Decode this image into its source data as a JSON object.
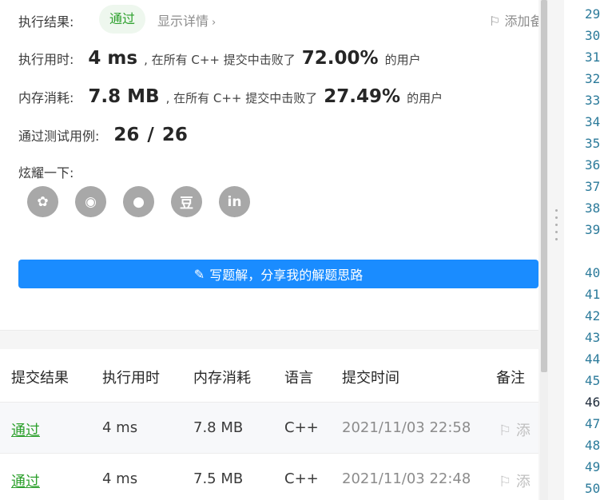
{
  "result": {
    "status_label": "执行结果:",
    "status_badge": "通过",
    "details_link": "显示详情",
    "details_chevron": "›",
    "add_note": "添加备",
    "runtime": {
      "label": "执行用时:",
      "value": "4 ms",
      "beat_prefix": ", 在所有 C++ 提交中击败了",
      "percent": "72.00%",
      "suffix": "的用户"
    },
    "memory": {
      "label": "内存消耗:",
      "value": "7.8 MB",
      "beat_prefix": ", 在所有 C++ 提交中击败了",
      "percent": "27.49%",
      "suffix": "的用户"
    },
    "testcases": {
      "label": "通过测试用例:",
      "passed": "26",
      "separator": "/",
      "total": "26"
    },
    "share": {
      "label": "炫耀一下:",
      "icons": [
        {
          "name": "wechat-icon",
          "glyph": "✿"
        },
        {
          "name": "weibo-icon",
          "glyph": "◉"
        },
        {
          "name": "qq-icon",
          "glyph": "●"
        },
        {
          "name": "douban-icon",
          "glyph": "豆"
        },
        {
          "name": "linkedin-icon",
          "glyph": "in"
        }
      ]
    },
    "write_solution_button": "写题解，分享我的解题思路",
    "pencil_glyph": "✎"
  },
  "table": {
    "headers": [
      "提交结果",
      "执行用时",
      "内存消耗",
      "语言",
      "提交时间",
      "备注"
    ],
    "rows": [
      {
        "result": "通过",
        "runtime": "4 ms",
        "memory": "7.8 MB",
        "language": "C++",
        "time": "2021/11/03 22:58",
        "note": "添"
      },
      {
        "result": "通过",
        "runtime": "4 ms",
        "memory": "7.5 MB",
        "language": "C++",
        "time": "2021/11/03 22:48",
        "note": "添"
      }
    ]
  },
  "editor": {
    "line_numbers": [
      "29",
      "30",
      "31",
      "32",
      "33",
      "34",
      "35",
      "36",
      "37",
      "38",
      "39",
      "40",
      "41",
      "42",
      "43",
      "44",
      "45",
      "46",
      "47",
      "48",
      "49",
      "50"
    ],
    "active_line": "46"
  },
  "colors": {
    "accent": "#1a8cff",
    "success": "#2ca02c",
    "muted": "#8c8c8c"
  }
}
